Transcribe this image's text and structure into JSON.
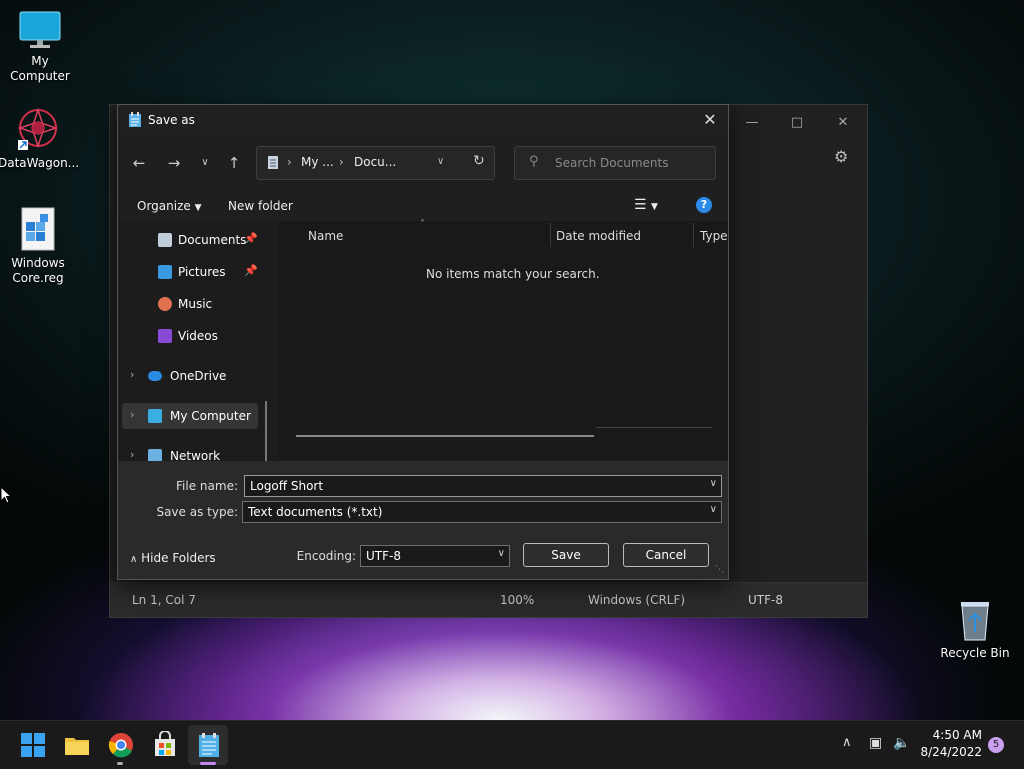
{
  "desktop": {
    "icons": [
      {
        "label": "My Computer"
      },
      {
        "label": "DataWagon..."
      },
      {
        "label": "Windows Core.reg"
      },
      {
        "label": "Recycle Bin"
      }
    ]
  },
  "notepad_bg": {
    "status": {
      "position": "Ln 1, Col 7",
      "zoom": "100%",
      "line_ending": "Windows (CRLF)",
      "encoding": "UTF-8"
    }
  },
  "dialog": {
    "title": "Save as",
    "address": {
      "segment1": "My ...",
      "segment2": "Docu..."
    },
    "search_placeholder": "Search Documents",
    "toolbar": {
      "organize": "Organize",
      "new_folder": "New folder"
    },
    "nav_items": [
      {
        "label": "Documents"
      },
      {
        "label": "Pictures"
      },
      {
        "label": "Music"
      },
      {
        "label": "Videos"
      },
      {
        "label": "OneDrive"
      },
      {
        "label": "My Computer"
      },
      {
        "label": "Network"
      }
    ],
    "columns": {
      "name": "Name",
      "date_modified": "Date modified",
      "type": "Type"
    },
    "empty_message": "No items match your search.",
    "file_name_label": "File name:",
    "file_name_value": "Logoff Short",
    "save_type_label": "Save as type:",
    "save_type_value": "Text documents (*.txt)",
    "hide_folders": "Hide Folders",
    "encoding_label": "Encoding:",
    "encoding_value": "UTF-8",
    "save_button": "Save",
    "cancel_button": "Cancel"
  },
  "taskbar": {
    "time": "4:50 AM",
    "date": "8/24/2022",
    "notification_count": "5"
  },
  "colors": {
    "accent": "#4aa3ff",
    "taskbar_bg": "#1a1a1a",
    "dialog_bg": "#1c1c1c"
  }
}
